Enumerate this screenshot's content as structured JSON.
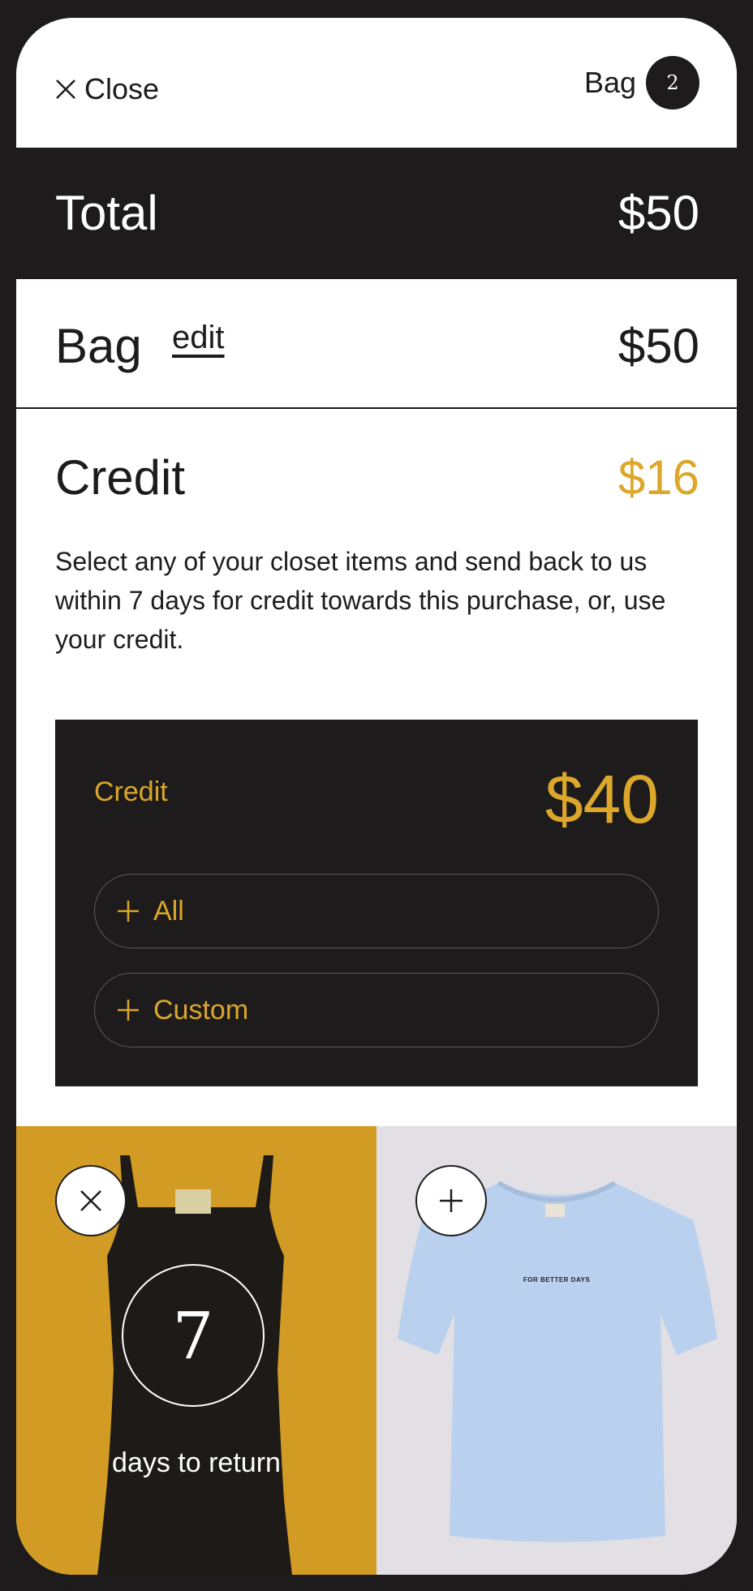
{
  "header": {
    "close_label": "Close",
    "bag_label": "Bag",
    "bag_count": "2"
  },
  "summary": {
    "total_label": "Total",
    "total_amount": "$50",
    "bag_label": "Bag",
    "edit_label": "edit",
    "bag_amount": "$50",
    "credit_label": "Credit",
    "credit_amount": "$16",
    "credit_description": "Select any of your closet items and send back to us within 7 days for credit towards this purchase, or, use your credit."
  },
  "credit_card": {
    "title": "Credit",
    "amount": "$40",
    "all_label": "All",
    "custom_label": "Custom"
  },
  "products": [
    {
      "name": "black tank top",
      "action_icon": "close-icon",
      "days_number": "7",
      "days_text": "days to return",
      "background": "#d29c24"
    },
    {
      "name": "light blue t-shirt",
      "action_icon": "plus-icon",
      "print_text": "FOR BETTER DAYS",
      "background": "#e2e0e4"
    }
  ],
  "colors": {
    "dark": "#1d1b1c",
    "accent": "#dca72a",
    "white": "#ffffff"
  }
}
